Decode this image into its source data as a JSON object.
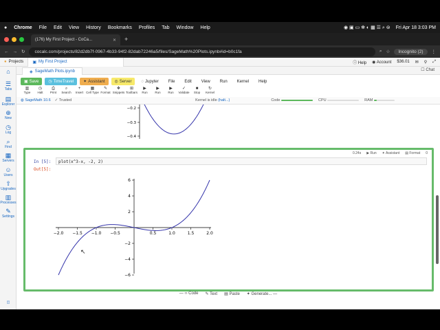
{
  "menubar": {
    "apple": "",
    "items": [
      "Chrome",
      "File",
      "Edit",
      "View",
      "History",
      "Bookmarks",
      "Profiles",
      "Tab",
      "Window",
      "Help"
    ],
    "datetime": "Fri Apr 18  3:03 PM"
  },
  "browser": {
    "tab_title": "(176) My First Project - CoCa...",
    "url": "cocalc.com/projects/82d2db7f-0967-4b33-94f2-82dab72246a5/files/SageMath%20Plots.ipynb#id=b0c1fa",
    "incognito": "Incognito (2)"
  },
  "cocalc": {
    "projects": "Projects",
    "project_tab": "My First Project",
    "help": "Help",
    "account": "Account",
    "balance": "$36.01",
    "chat": "Chat",
    "file_tab": "SageMath Plots.ipynb",
    "sidebar": [
      {
        "icon": "home-icon",
        "label": "",
        "glyph": "⌂"
      },
      {
        "icon": "tabs-icon",
        "label": "Tabs",
        "glyph": "☰"
      },
      {
        "icon": "explorer-icon",
        "label": "Explorer",
        "glyph": "▤"
      },
      {
        "icon": "new-icon",
        "label": "New",
        "glyph": "⊕"
      },
      {
        "icon": "log-icon",
        "label": "Log",
        "glyph": "◷"
      },
      {
        "icon": "find-icon",
        "label": "Find",
        "glyph": "⌕"
      },
      {
        "icon": "servers-icon",
        "label": "Servers",
        "glyph": "▦"
      },
      {
        "icon": "users-icon",
        "label": "Users",
        "glyph": "☺"
      },
      {
        "icon": "upgrades-icon",
        "label": "Upgrades",
        "glyph": "⇧"
      },
      {
        "icon": "processes-icon",
        "label": "Processes",
        "glyph": "▥"
      },
      {
        "icon": "settings-icon",
        "label": "Settings",
        "glyph": "✎"
      }
    ],
    "toolbar": {
      "save": "Save",
      "timetravel": "TimeTravel",
      "assistant": "Assistant",
      "server": "Server",
      "menus": [
        "Jupyter",
        "File",
        "Edit",
        "View",
        "Run",
        "Kernel",
        "Help"
      ]
    },
    "toolbar2": [
      "Type",
      "Halt",
      "Print",
      "Search",
      "Insert",
      "Cell Type",
      "Format",
      "Snippets",
      "Toolbars",
      "Run",
      "Run",
      "Run",
      "Validate",
      "Stop",
      "Kernel"
    ],
    "kernel_name": "SageMath 10.6",
    "trusted": "Trusted",
    "kernel_status": "Kernel is idle",
    "halt": "(halt...)",
    "code_label": "Code",
    "cpu_label": "CPU",
    "ram_label": "RAM",
    "cell_header": {
      "time": "0.24s",
      "run": "Run",
      "assistant": "Assistant",
      "format": "Format",
      "count": "0"
    },
    "in_prompt": "In [5]:",
    "code": "plot(x^3-x, -2, 2)",
    "out_prompt": "Out[5]:",
    "insert_bar": [
      "Code",
      "Text",
      "Paste",
      "Generate..."
    ]
  },
  "chart_data": [
    {
      "type": "line",
      "title": "",
      "y_ticks_visible": [
        "−0.2",
        "−0.3",
        "−0.4"
      ],
      "note": "partial previous output, parabola-like curve bottoming near y=−0.385",
      "y_min_visible": -0.4
    },
    {
      "type": "line",
      "function": "x^3-x",
      "x": [
        -2.0,
        -1.5,
        -1.0,
        -0.5,
        0.0,
        0.5,
        1.0,
        1.5,
        2.0
      ],
      "y": [
        -6.0,
        -1.875,
        0.0,
        0.375,
        0.0,
        -0.375,
        0.0,
        1.875,
        6.0
      ],
      "xlim": [
        -2,
        2
      ],
      "ylim": [
        -6,
        6
      ],
      "x_ticks": [
        "−2.0",
        "−1.5",
        "−1.0",
        "−0.5",
        "0.5",
        "1.0",
        "1.5",
        "2.0"
      ],
      "y_ticks": [
        "−6",
        "−4",
        "−2",
        "2",
        "4",
        "6"
      ],
      "color": "#3333aa"
    }
  ]
}
